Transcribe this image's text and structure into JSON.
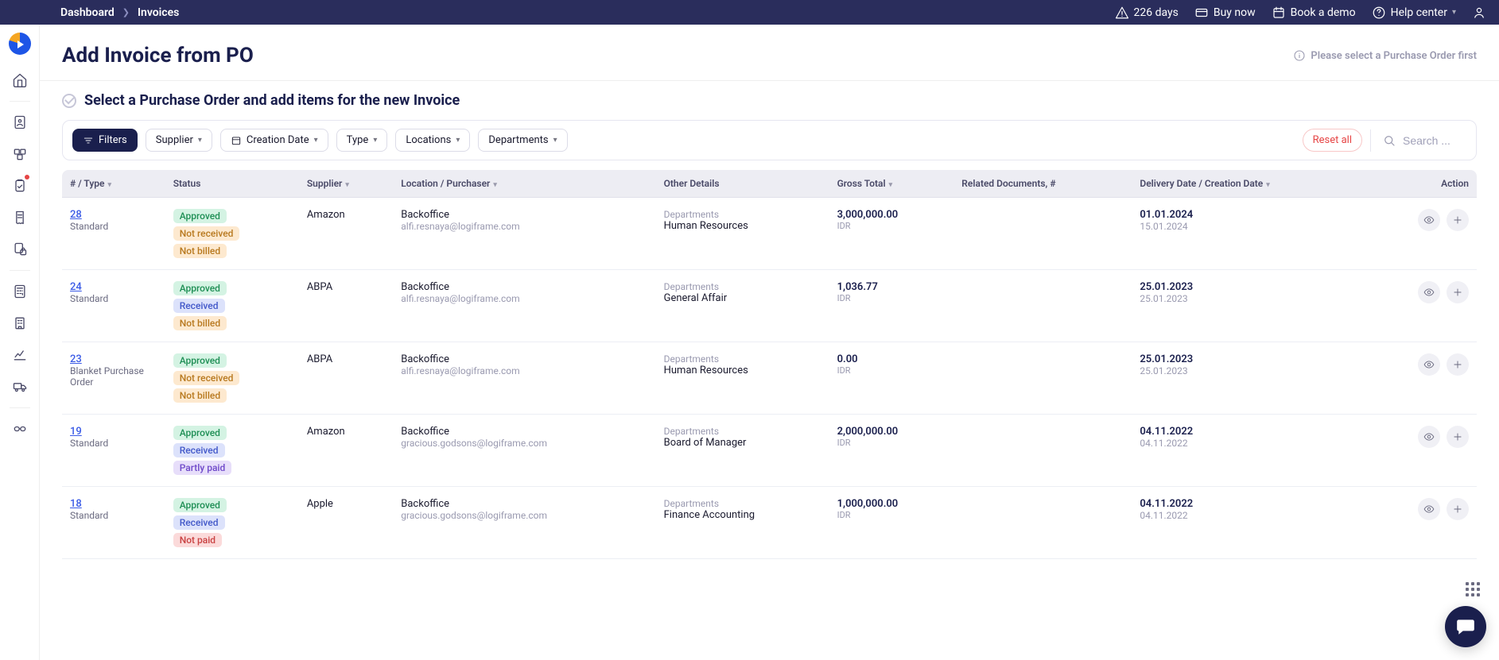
{
  "breadcrumb": {
    "dashboard": "Dashboard",
    "invoices": "Invoices"
  },
  "topbar": {
    "days": "226 days",
    "buy_now": "Buy now",
    "book_demo": "Book a demo",
    "help_center": "Help center"
  },
  "page": {
    "title": "Add Invoice from PO",
    "hint": "Please select a Purchase Order first",
    "section_title": "Select a Purchase Order and add items for the new Invoice"
  },
  "filters": {
    "filters_label": "Filters",
    "supplier": "Supplier",
    "creation_date": "Creation Date",
    "type": "Type",
    "locations": "Locations",
    "departments": "Departments",
    "reset": "Reset all",
    "search_placeholder": "Search ..."
  },
  "columns": {
    "numtype": "# / Type",
    "status": "Status",
    "supplier": "Supplier",
    "location": "Location / Purchaser",
    "other": "Other Details",
    "gross": "Gross Total",
    "related": "Related Documents, #",
    "dates": "Delivery Date / Creation Date",
    "action": "Action"
  },
  "labels": {
    "departments": "Departments"
  },
  "badge_labels": {
    "approved": "Approved",
    "not_received": "Not received",
    "received": "Received",
    "not_billed": "Not billed",
    "partly_paid": "Partly paid",
    "not_paid": "Not paid"
  },
  "rows": [
    {
      "num": "28",
      "type": "Standard",
      "badges": [
        "approved",
        "not_received",
        "not_billed"
      ],
      "supplier": "Amazon",
      "location": "Backoffice",
      "purchaser": "alfi.resnaya@logiframe.com",
      "dept": "Human Resources",
      "amount": "3,000,000.00",
      "currency": "IDR",
      "date1": "01.01.2024",
      "date2": "15.01.2024"
    },
    {
      "num": "24",
      "type": "Standard",
      "badges": [
        "approved",
        "received",
        "not_billed"
      ],
      "supplier": "ABPA",
      "location": "Backoffice",
      "purchaser": "alfi.resnaya@logiframe.com",
      "dept": "General Affair",
      "amount": "1,036.77",
      "currency": "IDR",
      "date1": "25.01.2023",
      "date2": "25.01.2023"
    },
    {
      "num": "23",
      "type": "Blanket Purchase Order",
      "badges": [
        "approved",
        "not_received",
        "not_billed"
      ],
      "supplier": "ABPA",
      "location": "Backoffice",
      "purchaser": "alfi.resnaya@logiframe.com",
      "dept": "Human Resources",
      "amount": "0.00",
      "currency": "IDR",
      "date1": "25.01.2023",
      "date2": "25.01.2023"
    },
    {
      "num": "19",
      "type": "Standard",
      "badges": [
        "approved",
        "received",
        "partly_paid"
      ],
      "supplier": "Amazon",
      "location": "Backoffice",
      "purchaser": "gracious.godsons@logiframe.com",
      "dept": "Board of Manager",
      "amount": "2,000,000.00",
      "currency": "IDR",
      "date1": "04.11.2022",
      "date2": "04.11.2022"
    },
    {
      "num": "18",
      "type": "Standard",
      "badges": [
        "approved",
        "received",
        "not_paid"
      ],
      "supplier": "Apple",
      "location": "Backoffice",
      "purchaser": "gracious.godsons@logiframe.com",
      "dept": "Finance Accounting",
      "amount": "1,000,000.00",
      "currency": "IDR",
      "date1": "04.11.2022",
      "date2": "04.11.2022"
    }
  ]
}
